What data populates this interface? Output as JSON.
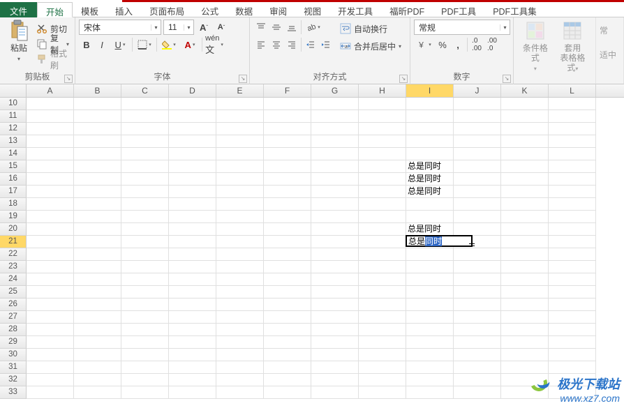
{
  "tabs": {
    "file": "文件",
    "items": [
      "开始",
      "模板",
      "插入",
      "页面布局",
      "公式",
      "数据",
      "审阅",
      "视图",
      "开发工具",
      "福昕PDF",
      "PDF工具",
      "PDF工具集"
    ],
    "active_index": 0
  },
  "ribbon": {
    "clipboard": {
      "label": "剪贴板",
      "paste": "粘贴",
      "cut": "剪切",
      "copy": "复制",
      "format_painter": "格式刷"
    },
    "font": {
      "label": "字体",
      "name": "宋体",
      "size": "11",
      "bold": "B",
      "italic": "I",
      "underline": "U"
    },
    "alignment": {
      "label": "对齐方式",
      "wrap": "自动换行",
      "merge": "合并后居中"
    },
    "number": {
      "label": "数字",
      "format": "常规"
    },
    "styles": {
      "cond": "条件格式",
      "table": "套用\n表格格式",
      "trunc": "常",
      "trunc2": "适中"
    }
  },
  "grid": {
    "columns": [
      "A",
      "B",
      "C",
      "D",
      "E",
      "F",
      "G",
      "H",
      "I",
      "J",
      "K",
      "L"
    ],
    "first_row": 10,
    "last_row": 33,
    "active_col": "I",
    "active_row": 21,
    "cells": {
      "I15": "总是同时",
      "I16": "总是同时",
      "I17": "总是同时",
      "I20": "总是同时"
    },
    "editing": {
      "row": 21,
      "col": "I",
      "value_plain": "总是",
      "value_suggest": "同时"
    }
  },
  "watermark": {
    "name": "极光下载站",
    "url": "www.xz7.com"
  }
}
